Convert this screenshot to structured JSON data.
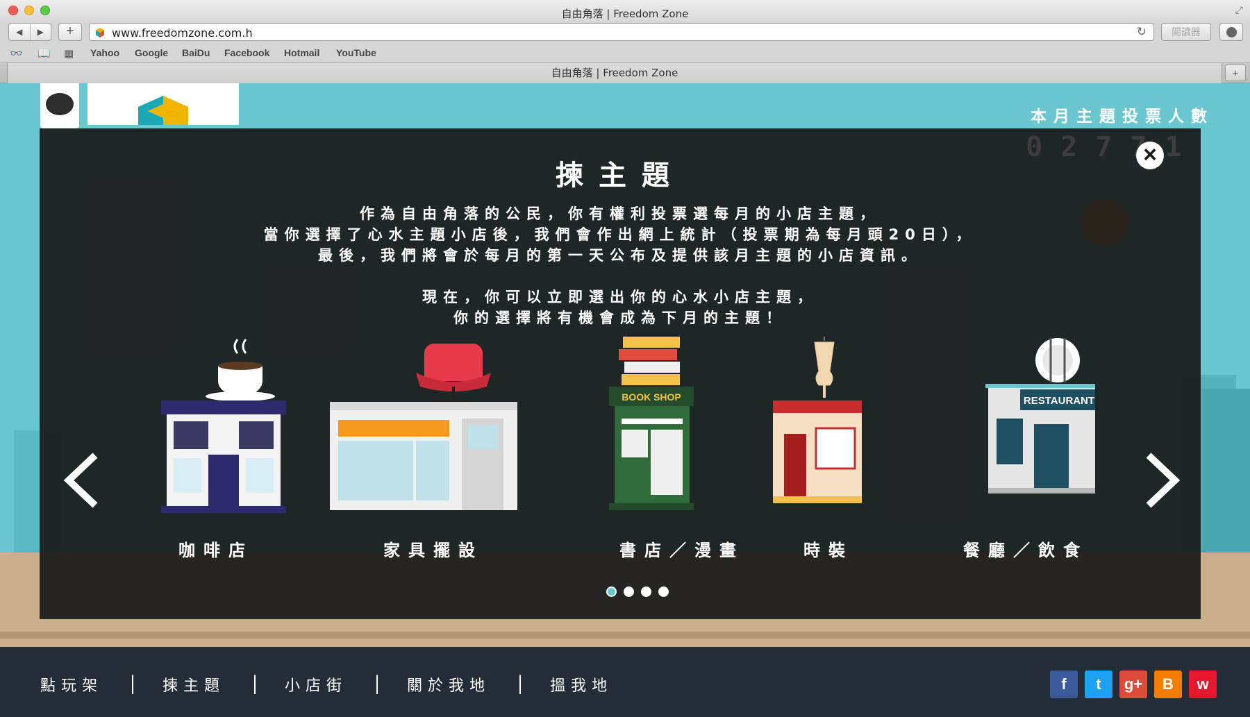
{
  "browser": {
    "window_title": "自由角落 | Freedom Zone",
    "url": "www.freedomzone.com.h",
    "reader_label": "閱讀器",
    "bookmarks": [
      "Yahoo",
      "Google",
      "BaiDu",
      "Facebook",
      "Hotmail",
      "YouTube"
    ],
    "tab_title": "自由角落 | Freedom Zone"
  },
  "page": {
    "vote_counter_label": "本月主題投票人數",
    "vote_counter_digits": "02771",
    "modal": {
      "title": "揀主題",
      "intro_lines": [
        "作為自由角落的公民，你有權利投票選每月的小店主題，",
        "當你選擇了心水主題小店後，我們會作出網上統計（投票期為每月頭20日），",
        "最後，我們將會於每月的第一天公布及提供該月主題的小店資訊。",
        "現在，你可以立即選出你的心水小店主題，",
        "你的選擇將有機會成為下月的主題！"
      ],
      "shops": [
        {
          "label": "咖啡店"
        },
        {
          "label": "家具擺設"
        },
        {
          "label": "書店／漫畫",
          "sign": "BOOK SHOP"
        },
        {
          "label": "時裝"
        },
        {
          "label": "餐廳／飲食",
          "sign": "RESTAURANT"
        }
      ],
      "pagination": {
        "total": 4,
        "active": 0
      }
    },
    "footer": {
      "nav": [
        "點玩架",
        "揀主題",
        "小店街",
        "關於我地",
        "搵我地"
      ],
      "social": [
        {
          "icon": "facebook-icon",
          "glyph": "f",
          "color": "#3b5998"
        },
        {
          "icon": "twitter-icon",
          "glyph": "t",
          "color": "#1da1f2"
        },
        {
          "icon": "google-plus-icon",
          "glyph": "g+",
          "color": "#dd4b39"
        },
        {
          "icon": "blogger-icon",
          "glyph": "B",
          "color": "#f57d00"
        },
        {
          "icon": "weibo-icon",
          "glyph": "w",
          "color": "#e6162d"
        }
      ]
    }
  }
}
